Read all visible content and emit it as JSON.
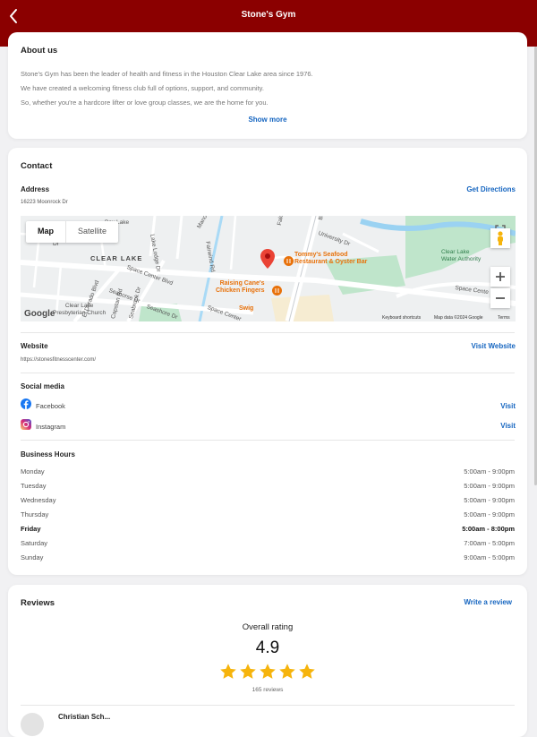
{
  "header": {
    "title": "Stone's Gym"
  },
  "colors": {
    "brand": "#8b0000",
    "link": "#1565c0",
    "star": "#f6b40c"
  },
  "about": {
    "title": "About us",
    "lines": [
      "Stone's Gym has been the leader of health and fitness in the Houston Clear Lake area since 1976.",
      "We have created a welcoming fitness club full of options, support, and community.",
      "So, whether you're a hardcore lifter or love group classes, we are the home for you."
    ],
    "show_more": "Show more"
  },
  "contact": {
    "title": "Contact",
    "address_label": "Address",
    "address": "16223 Moonrock Dr",
    "directions": "Get Directions",
    "map": {
      "tabs": [
        "Map",
        "Satellite"
      ],
      "labels": {
        "clear_lake": "CLEAR LAKE",
        "presbyterian": "Clear Lake\nPresbyterian Church",
        "space_center": "Space Center Blvd",
        "space_center2": "Space Center",
        "space_center3": "Space Cente",
        "seafood": "Tommy's Seafood\nRestaurant & Oyster Bar",
        "canes": "Raising Cane's\nChicken Fingers",
        "swig": "Swig",
        "water": "Clear Lake\nWater Authority",
        "university": "University Dr",
        "el_dorado": "El Dorado Blvd",
        "seahorse": "Seahorse Dr",
        "manor": "Manor Square",
        "lake_ridge": "Lake Ridge",
        "falcon": "Falcon Pass",
        "capstan": "Capstan Rd",
        "seabrook": "Seabrook Dr",
        "seashore": "Seashore Dr",
        "bay_lake": "Bay Lake",
        "lake_lodge": "Lake Lodge Dr",
        "fairwind": "Fairwind Rd",
        "dr": "Dr",
        "bl": "Bl"
      },
      "google": "Google",
      "shortcuts": "Keyboard shortcuts",
      "map_data": "Map data ©2024 Google",
      "terms": "Terms"
    },
    "website_label": "Website",
    "website": "https://stonesfitnesscenter.com/",
    "visit_website": "Visit Website",
    "social_label": "Social media",
    "social": [
      {
        "name": "Facebook",
        "action": "Visit",
        "icon": "facebook-icon"
      },
      {
        "name": "Instagram",
        "action": "Visit",
        "icon": "instagram-icon"
      }
    ],
    "hours_label": "Business Hours",
    "hours": [
      {
        "day": "Monday",
        "time": "5:00am - 9:00pm"
      },
      {
        "day": "Tuesday",
        "time": "5:00am - 9:00pm"
      },
      {
        "day": "Wednesday",
        "time": "5:00am - 9:00pm"
      },
      {
        "day": "Thursday",
        "time": "5:00am - 9:00pm"
      },
      {
        "day": "Friday",
        "time": "5:00am - 8:00pm",
        "today": true
      },
      {
        "day": "Saturday",
        "time": "7:00am - 5:00pm"
      },
      {
        "day": "Sunday",
        "time": "9:00am - 5:00pm"
      }
    ]
  },
  "reviews": {
    "title": "Reviews",
    "write": "Write a review",
    "overall_label": "Overall rating",
    "rating": "4.9",
    "stars": 5,
    "count": "165 reviews",
    "first_reviewer": "Christian Sch..."
  }
}
